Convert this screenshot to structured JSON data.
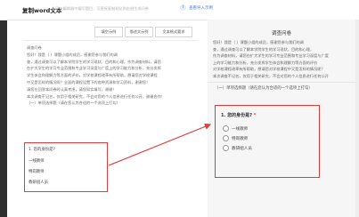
{
  "header": {
    "app_title": "复制word文本",
    "description": "若已在编辑器中编写题目，可直接复制粘贴到右侧生成问卷",
    "hint": "查看导入示例"
  },
  "toolbar": {
    "buttons": [
      "填空示例",
      "描述文示例",
      "文本格式要求"
    ]
  },
  "editor": {
    "lines": [
      "调查问卷",
      "您好！我是（                    ）课题小组的成员，感谢您参与我们的调",
      "查，通过调查可以了解本学院学生的学习现状、目的和心理，作为调查材料，请您",
      "在扩大学生的学习专业范围和专业学习深度与广度上的学习能力和分析，充分发挥",
      "学生体会和理解力等方面的评价，对学校课程改革有所帮助，想请您对学校课程",
      "中又是怎样的情况呢？全面的课程设置下的各种资源和学习资料，谢谢您！",
      "请您在回答本问卷时认真考虑，请您如实填写，谢谢！",
      "本次调查不记名，仅用于相关研究，不会对您的个人信息进行任何公开，谢谢合作！",
      "（一）单项选择题（请在您认为合适的一个选项上打勾）"
    ],
    "question": "1. 您的身份是?",
    "options": [
      "一线教师",
      "特岗教师",
      "教研组人员"
    ]
  },
  "preview": {
    "title": "调查问卷",
    "body_lines": [
      "您好！我是（            ）课题小组的成员，感谢您参与我们的调",
      "查，通过调查可以了解本学院学生的学习现状，目的和心理，",
      "作为调查材料，请您在扩大学生的学习专业范围和专业学习深度与广度",
      "上的学习能力和分析，充分发挥学生体会和理解力等方面的评价",
      "对学校课程改革有所帮助，想请您对学校课程中又是怎样的情况呢？",
      "本次调查不记名，仅用于相关研究，不会对您的个人信息进行任何公开"
    ],
    "section": "（一）单项选择题（请在您认为合适的一个选项上打勾）",
    "question_num": "1.",
    "question_text": "您的身份是?",
    "required_mark": "*",
    "options": [
      "一线教师",
      "特岗教师",
      "教研组人员"
    ]
  },
  "colors": {
    "highlight": "#e23b3b",
    "accent": "#4a7bd6"
  }
}
